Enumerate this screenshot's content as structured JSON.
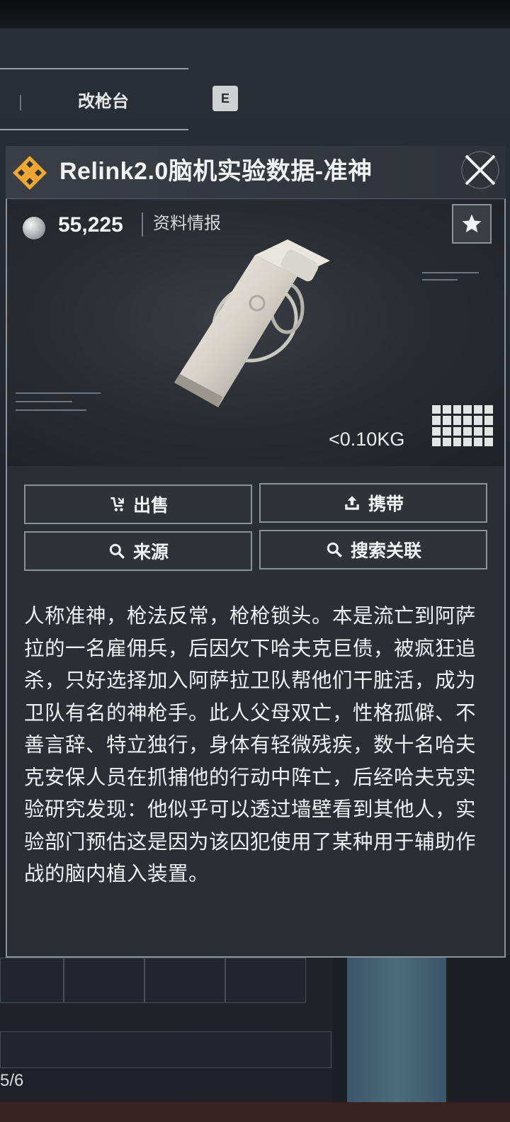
{
  "background": {
    "tab_label": "改枪台",
    "hotkey": "E",
    "page_count": "5/6"
  },
  "item": {
    "name": "Relink2.0脑机实验数据-准神",
    "price": "55,225",
    "category": "资料情报",
    "weight": "<0.10KG",
    "image": "usb-drive-with-keyring",
    "rarity_color": "#f0a830"
  },
  "actions": {
    "sell": "出售",
    "carry": "携带",
    "source": "来源",
    "search_related": "搜索关联"
  },
  "description": "人称准神，枪法反常，枪枪锁头。本是流亡到阿萨拉的一名雇佣兵，后因欠下哈夫克巨债，被疯狂追杀，只好选择加入阿萨拉卫队帮他们干脏活，成为卫队有名的神枪手。此人父母双亡，性格孤僻、不善言辞、特立独行，身体有轻微残疾，数十名哈夫克安保人员在抓捕他的行动中阵亡，后经哈夫克实验研究发现：他似乎可以透过墙壁看到其他人，实验部门预估这是因为该囚犯使用了某种用于辅助作战的脑内植入装置。"
}
